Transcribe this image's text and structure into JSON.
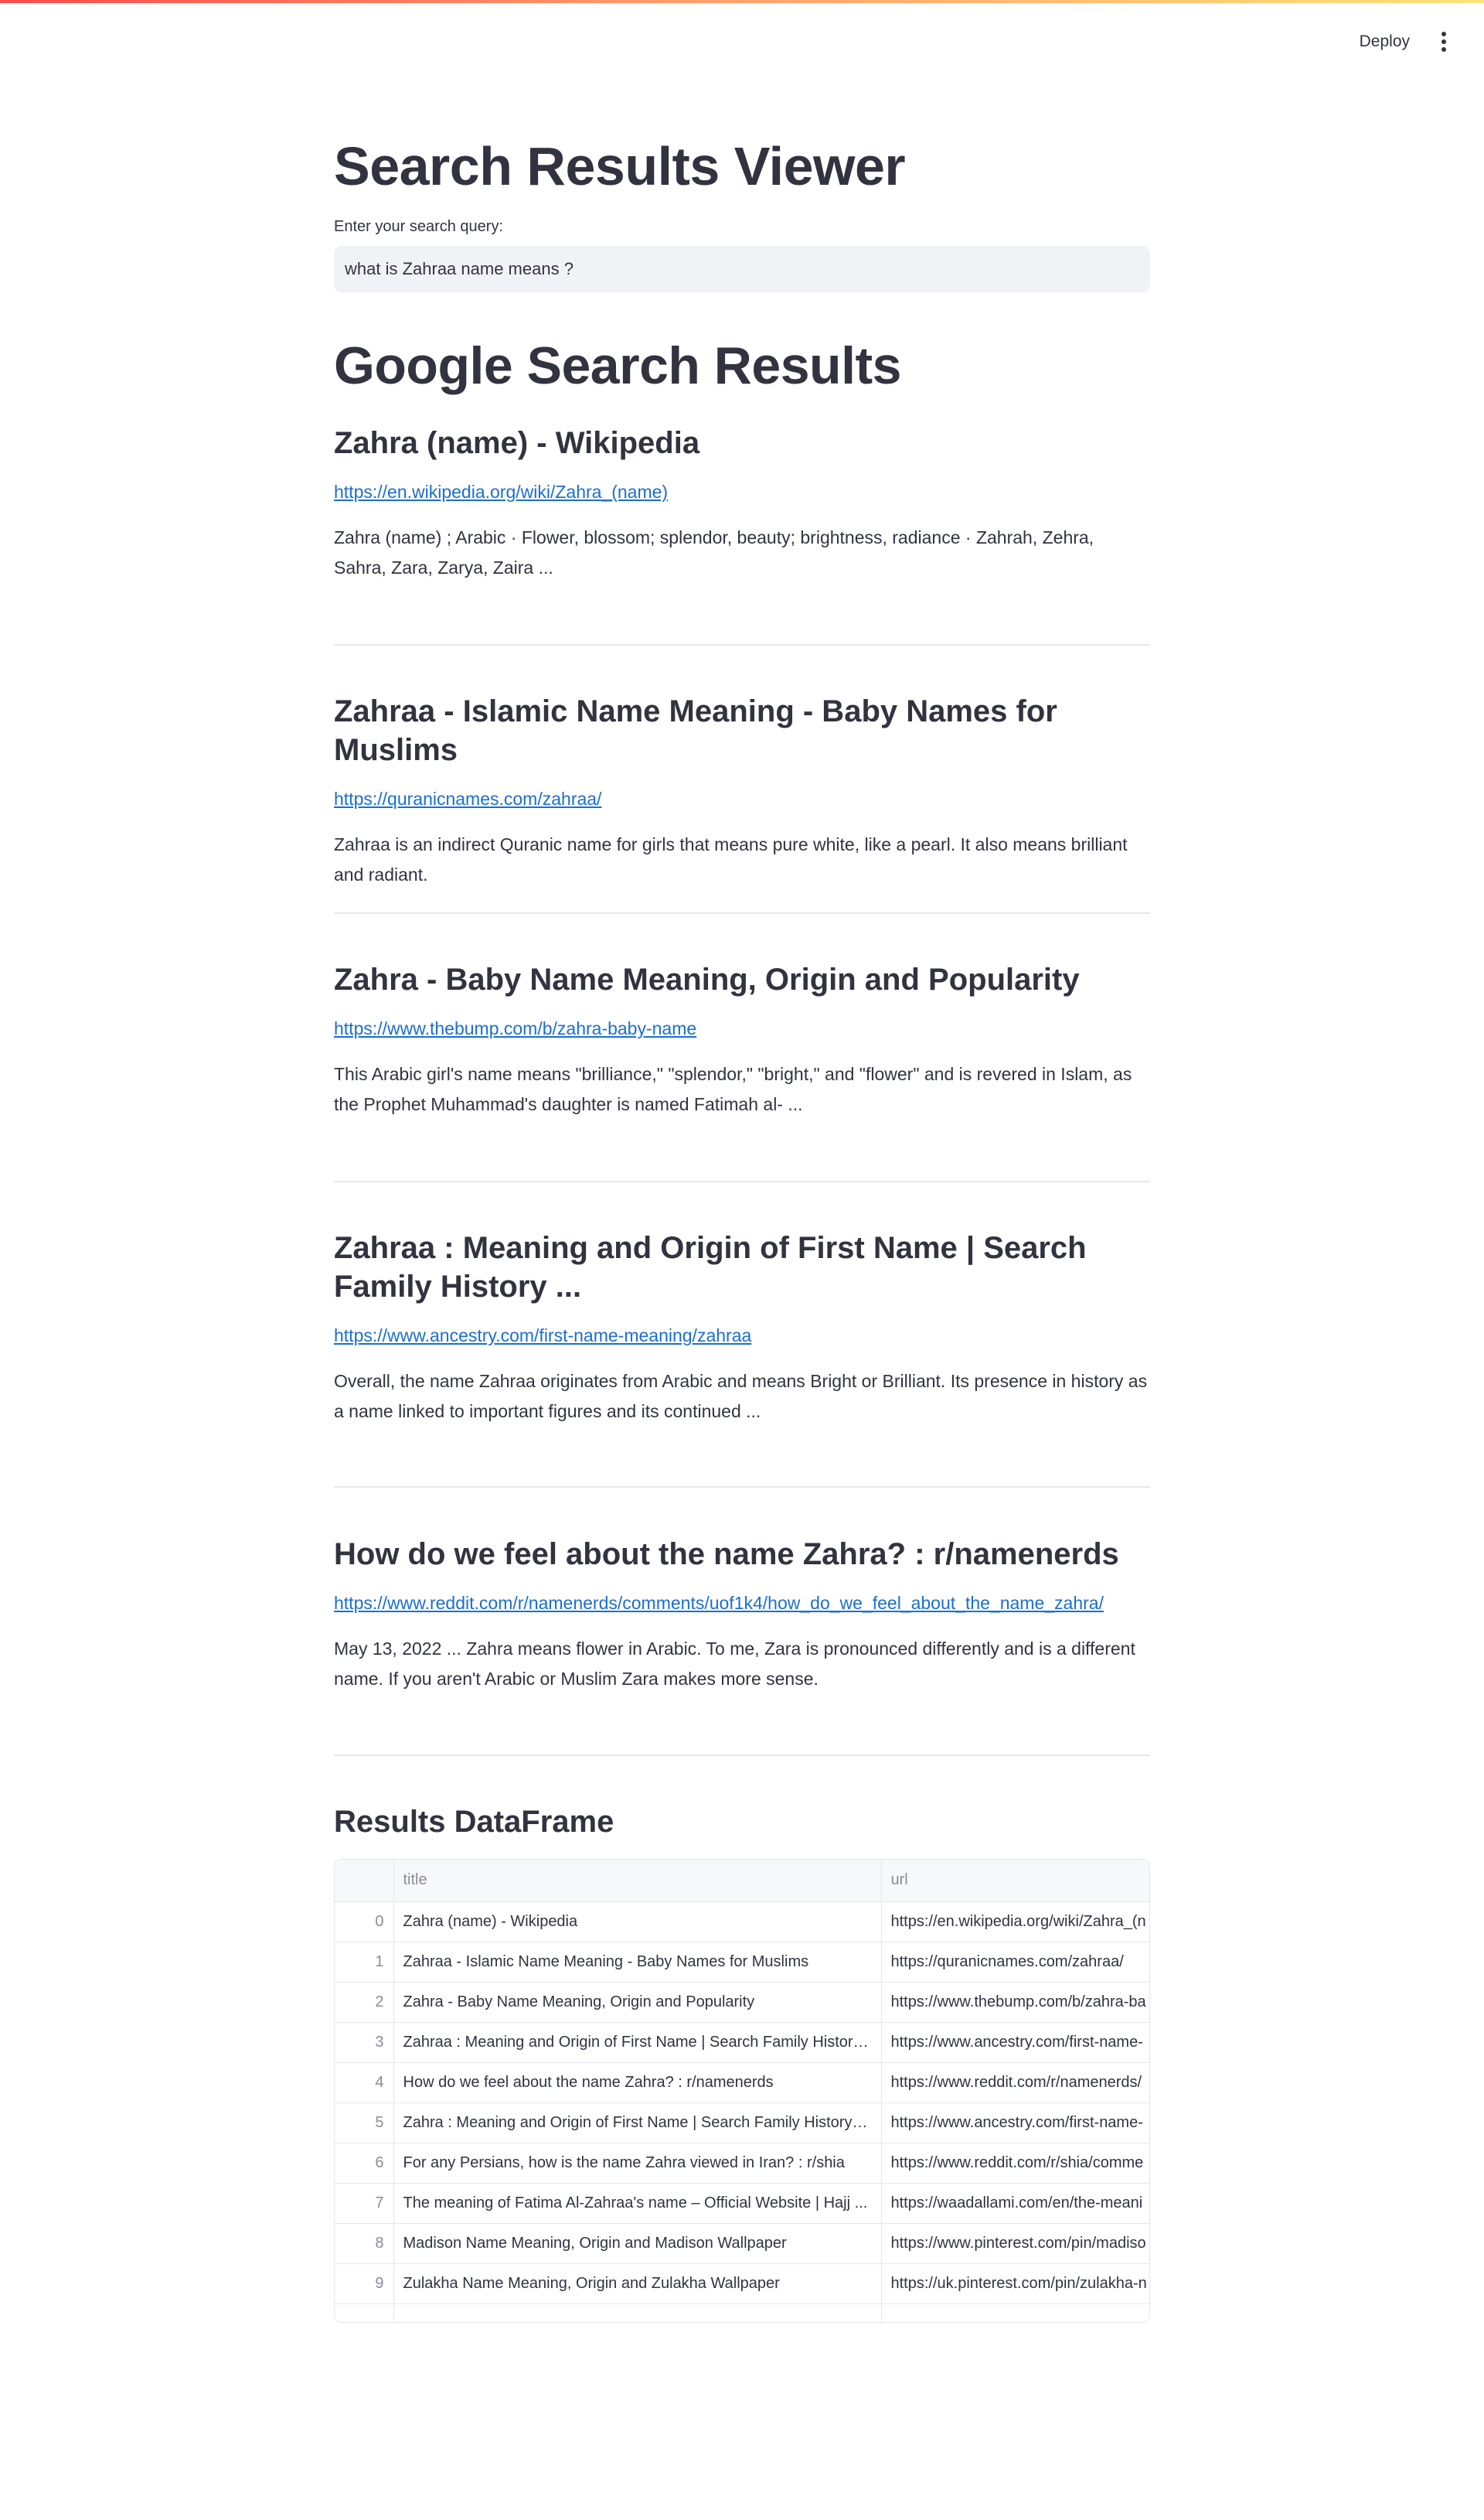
{
  "toolbar": {
    "deploy_label": "Deploy"
  },
  "app": {
    "title": "Search Results Viewer",
    "query_label": "Enter your search query:",
    "query_value": "what is Zahraa name means ?"
  },
  "google": {
    "section_title": "Google Search Results",
    "results": [
      {
        "title": "Zahra (name) - Wikipedia",
        "url": "https://en.wikipedia.org/wiki/Zahra_(name)",
        "snippet": "Zahra (name) ; Arabic · Flower, blossom; splendor, beauty; brightness, radiance · Zahrah, Zehra, Sahra, Zara, Zarya, Zaira ..."
      },
      {
        "title": "Zahraa - Islamic Name Meaning - Baby Names for Muslims",
        "url": "https://quranicnames.com/zahraa/",
        "snippet": "Zahraa is an indirect Quranic name for girls that means pure white, like a pearl. It also means brilliant and radiant."
      },
      {
        "title": "Zahra - Baby Name Meaning, Origin and Popularity",
        "url": "https://www.thebump.com/b/zahra-baby-name",
        "snippet": "This Arabic girl's name means \"brilliance,\" \"splendor,\" \"bright,\" and \"flower\" and is revered in Islam, as the Prophet Muhammad's daughter is named Fatimah al- ..."
      },
      {
        "title": "Zahraa : Meaning and Origin of First Name | Search Family History ...",
        "url": "https://www.ancestry.com/first-name-meaning/zahraa",
        "snippet": "Overall, the name Zahraa originates from Arabic and means Bright or Brilliant. Its presence in history as a name linked to important figures and its continued ..."
      },
      {
        "title": "How do we feel about the name Zahra? : r/namenerds",
        "url": "https://www.reddit.com/r/namenerds/comments/uof1k4/how_do_we_feel_about_the_name_zahra/",
        "snippet": "May 13, 2022 ... Zahra means flower in Arabic. To me, Zara is pronounced differently and is a different name. If you aren't Arabic or Muslim Zara makes more sense."
      }
    ]
  },
  "dataframe": {
    "title": "Results DataFrame",
    "columns": [
      "title",
      "url"
    ],
    "rows": [
      {
        "index": "0",
        "title": "Zahra (name) - Wikipedia",
        "url": "https://en.wikipedia.org/wiki/Zahra_(n"
      },
      {
        "index": "1",
        "title": "Zahraa - Islamic Name Meaning - Baby Names for Muslims",
        "url": "https://quranicnames.com/zahraa/"
      },
      {
        "index": "2",
        "title": "Zahra - Baby Name Meaning, Origin and Popularity",
        "url": "https://www.thebump.com/b/zahra-ba"
      },
      {
        "index": "3",
        "title": "Zahraa : Meaning and Origin of First Name | Search Family History ...",
        "url": "https://www.ancestry.com/first-name-"
      },
      {
        "index": "4",
        "title": "How do we feel about the name Zahra? : r/namenerds",
        "url": "https://www.reddit.com/r/namenerds/"
      },
      {
        "index": "5",
        "title": "Zahra : Meaning and Origin of First Name | Search Family History on ...",
        "url": "https://www.ancestry.com/first-name-"
      },
      {
        "index": "6",
        "title": "For any Persians, how is the name Zahra viewed in Iran? : r/shia",
        "url": "https://www.reddit.com/r/shia/comme"
      },
      {
        "index": "7",
        "title": "The meaning of Fatima Al-Zahraa's name – Official Website | Hajj ...",
        "url": "https://waadallami.com/en/the-meani"
      },
      {
        "index": "8",
        "title": "Madison Name Meaning, Origin and Madison Wallpaper",
        "url": "https://www.pinterest.com/pin/madiso"
      },
      {
        "index": "9",
        "title": "Zulakha Name Meaning, Origin and Zulakha Wallpaper",
        "url": "https://uk.pinterest.com/pin/zulakha-n"
      }
    ]
  }
}
